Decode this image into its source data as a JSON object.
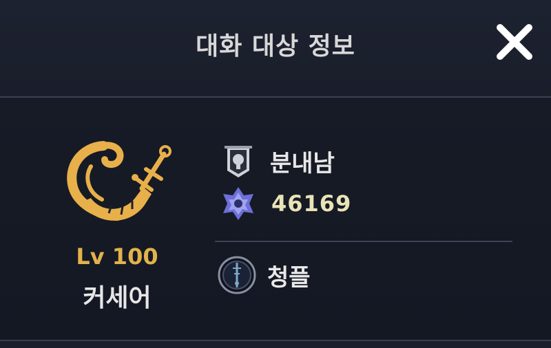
{
  "header": {
    "title": "대화 대상 정보",
    "close_icon": "close-icon"
  },
  "profile": {
    "class_icon": "horn-emblem-icon",
    "level": "Lv 100",
    "class_name": "커세어",
    "accent_color": "#e2b24b"
  },
  "info": {
    "name_icon": "banner-icon",
    "character_name": "분내남",
    "score_icon": "crest-icon",
    "power_score": "46169",
    "guild_icon": "guild-emblem-icon",
    "guild_name": "청플"
  }
}
